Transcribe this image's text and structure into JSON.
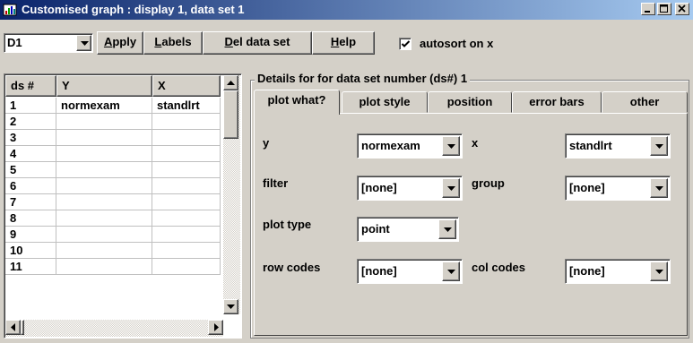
{
  "window": {
    "title": "Customised graph : display 1, data set 1"
  },
  "toolbar": {
    "display_select": "D1",
    "apply_prefix": "",
    "apply_ul": "A",
    "apply_rest": "pply",
    "labels_ul": "L",
    "labels_rest": "abels",
    "del_ul": "D",
    "del_rest": "el data set",
    "help_ul": "H",
    "help_rest": "elp",
    "autosort_label": "autosort on x",
    "autosort_checked": true
  },
  "grid": {
    "headers": [
      "ds #",
      "Y",
      "X"
    ],
    "rows": [
      {
        "ds": "1",
        "y": "normexam",
        "x": "standlrt"
      },
      {
        "ds": "2",
        "y": "",
        "x": ""
      },
      {
        "ds": "3",
        "y": "",
        "x": ""
      },
      {
        "ds": "4",
        "y": "",
        "x": ""
      },
      {
        "ds": "5",
        "y": "",
        "x": ""
      },
      {
        "ds": "6",
        "y": "",
        "x": ""
      },
      {
        "ds": "7",
        "y": "",
        "x": ""
      },
      {
        "ds": "8",
        "y": "",
        "x": ""
      },
      {
        "ds": "9",
        "y": "",
        "x": ""
      },
      {
        "ds": "10",
        "y": "",
        "x": ""
      },
      {
        "ds": "11",
        "y": "",
        "x": ""
      }
    ]
  },
  "details": {
    "title": "Details for for data set number (ds#) 1",
    "tabs": [
      "plot what?",
      "plot style",
      "position",
      "error bars",
      "other"
    ],
    "active_tab": "plot what?",
    "fields": {
      "y_label": "y",
      "y_value": "normexam",
      "x_label": "x",
      "x_value": "standlrt",
      "filter_label": "filter",
      "filter_value": "[none]",
      "group_label": "group",
      "group_value": "[none]",
      "plottype_label": "plot type",
      "plottype_value": "point",
      "rowcodes_label": "row codes",
      "rowcodes_value": "[none]",
      "colcodes_label": "col codes",
      "colcodes_value": "[none]"
    }
  }
}
